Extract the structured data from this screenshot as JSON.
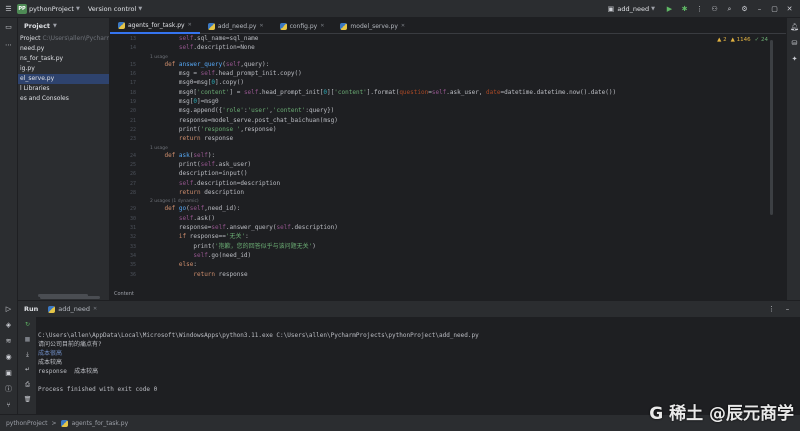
{
  "titlebar": {
    "project_badge": "PP",
    "project": "pythonProject",
    "vcs": "Version control",
    "run_config": "add_need",
    "icons": [
      "run-icon",
      "debug-icon",
      "more-icon",
      "add-user-icon",
      "search-icon",
      "settings-icon",
      "minimize-icon",
      "maximize-icon",
      "close-icon"
    ]
  },
  "project_panel": {
    "title": "Project",
    "rows": [
      {
        "label": "Project",
        "dim": " C:\\Users\\allen\\PycharmProjects\\pythonProject"
      },
      {
        "label": "need.py",
        "dim": ""
      },
      {
        "label": "ns_for_task.py",
        "dim": ""
      },
      {
        "label": "ig.py",
        "dim": ""
      },
      {
        "label": "el_serve.py",
        "dim": ""
      },
      {
        "label": "l Libraries",
        "dim": ""
      },
      {
        "label": "es and Consoles",
        "dim": ""
      }
    ],
    "selected_index": 4
  },
  "tabs": [
    {
      "label": "agents_for_task.py",
      "active": true
    },
    {
      "label": "add_need.py",
      "active": false
    },
    {
      "label": "config.py",
      "active": false
    },
    {
      "label": "model_serve.py",
      "active": false
    }
  ],
  "inspections": {
    "warnings": "▲ 2",
    "weak": "▲ 1146",
    "typos": "✓ 24"
  },
  "code_lines": [
    {
      "n": "13",
      "t": "line",
      "html": "        <span class='self'>self</span>.sql_name=sql_name"
    },
    {
      "n": "14",
      "t": "line",
      "html": "        <span class='self'>self</span>.description=None"
    },
    {
      "n": "",
      "t": "hint",
      "html": "1 usage"
    },
    {
      "n": "15",
      "t": "line",
      "html": "    <span class='kw'>def</span> <span class='fn'>answer_query</span>(<span class='self'>self</span>,query):"
    },
    {
      "n": "16",
      "t": "line",
      "html": "        msg = <span class='self'>self</span>.head_prompt_init.copy()"
    },
    {
      "n": "17",
      "t": "line",
      "html": "        msg0=msg[<span class='num'>0</span>].copy()"
    },
    {
      "n": "18",
      "t": "line",
      "html": "        msg0[<span class='str'>'content'</span>] = <span class='self'>self</span>.head_prompt_init[<span class='num'>0</span>][<span class='str'>'content'</span>].format(<span class='prm'>question</span>=<span class='self'>self</span>.ask_user, <span class='prm'>date</span>=datetime.datetime.now().date())"
    },
    {
      "n": "19",
      "t": "line",
      "html": "        msg[<span class='num'>0</span>]=msg0"
    },
    {
      "n": "20",
      "t": "line",
      "html": "        msg.append({<span class='str'>'role'</span>:<span class='str'>'user'</span>,<span class='str'>'content'</span>:query})"
    },
    {
      "n": "21",
      "t": "line",
      "html": "        response=model_serve.post_chat_baichuan(msg)"
    },
    {
      "n": "22",
      "t": "line",
      "html": "        print(<span class='str'>'response '</span>,response)"
    },
    {
      "n": "23",
      "t": "line",
      "html": "        <span class='kw'>return</span> response"
    },
    {
      "n": "",
      "t": "hint",
      "html": "1 usage"
    },
    {
      "n": "24",
      "t": "line",
      "html": "    <span class='kw'>def</span> <span class='fn'>ask</span>(<span class='self'>self</span>):"
    },
    {
      "n": "25",
      "t": "line",
      "html": "        print(<span class='self'>self</span>.ask_user)"
    },
    {
      "n": "26",
      "t": "line",
      "html": "        description=input()"
    },
    {
      "n": "27",
      "t": "line",
      "html": "        <span class='self'>self</span>.description=description"
    },
    {
      "n": "28",
      "t": "line",
      "html": "        <span class='kw'>return</span> description"
    },
    {
      "n": "",
      "t": "hint",
      "html": "2 usages (1 dynamic)"
    },
    {
      "n": "29",
      "t": "line",
      "html": "    <span class='kw'>def</span> <span class='fn'>go</span>(<span class='self'>self</span>,need_id):"
    },
    {
      "n": "30",
      "t": "line",
      "html": "        <span class='self'>self</span>.ask()"
    },
    {
      "n": "31",
      "t": "line",
      "html": "        response=<span class='self'>self</span>.answer_query(<span class='self'>self</span>.description)"
    },
    {
      "n": "32",
      "t": "line",
      "html": "        <span class='kw'>if</span> response==<span class='str'>'无关'</span>:"
    },
    {
      "n": "33",
      "t": "line",
      "html": "            print(<span class='str'>'抱歉，您的回答似乎与该问题无关'</span>)"
    },
    {
      "n": "34",
      "t": "line",
      "html": "            <span class='self'>self</span>.go(need_id)"
    },
    {
      "n": "35",
      "t": "line",
      "html": "        <span class='kw'>else</span>:"
    },
    {
      "n": "36",
      "t": "line",
      "html": "            <span class='kw'>return</span> response"
    }
  ],
  "editor": {
    "breadcrumb": "Content"
  },
  "run": {
    "label": "Run",
    "tab": "add_need",
    "console": [
      {
        "text": "C:\\Users\\allen\\AppData\\Local\\Microsoft\\WindowsApps\\python3.11.exe C:\\Users\\allen\\PycharmProjects\\pythonProject\\add_need.py",
        "color": "#bcbec4"
      },
      {
        "text": "请问公司目前的痛点有?",
        "color": "#bcbec4"
      },
      {
        "text": "成本很高",
        "color": "#6f8cc4"
      },
      {
        "text": "成本较高",
        "color": "#bcbec4"
      },
      {
        "text": "response  成本较高",
        "color": "#bcbec4"
      },
      {
        "text": "",
        "color": "#bcbec4"
      },
      {
        "text": "Process finished with exit code 0",
        "color": "#bcbec4"
      }
    ]
  },
  "statusbar": {
    "project": "pythonProject",
    "sep": ">",
    "file": "agents_for_task.py"
  },
  "watermark": "G 稀土 @辰元商学",
  "colors": {
    "bg": "#1e1f22",
    "panel": "#2b2d30",
    "accent": "#3574f0",
    "keyword": "#cf8e6d",
    "string": "#6aab73",
    "function": "#56a8f5",
    "self": "#94558d"
  }
}
